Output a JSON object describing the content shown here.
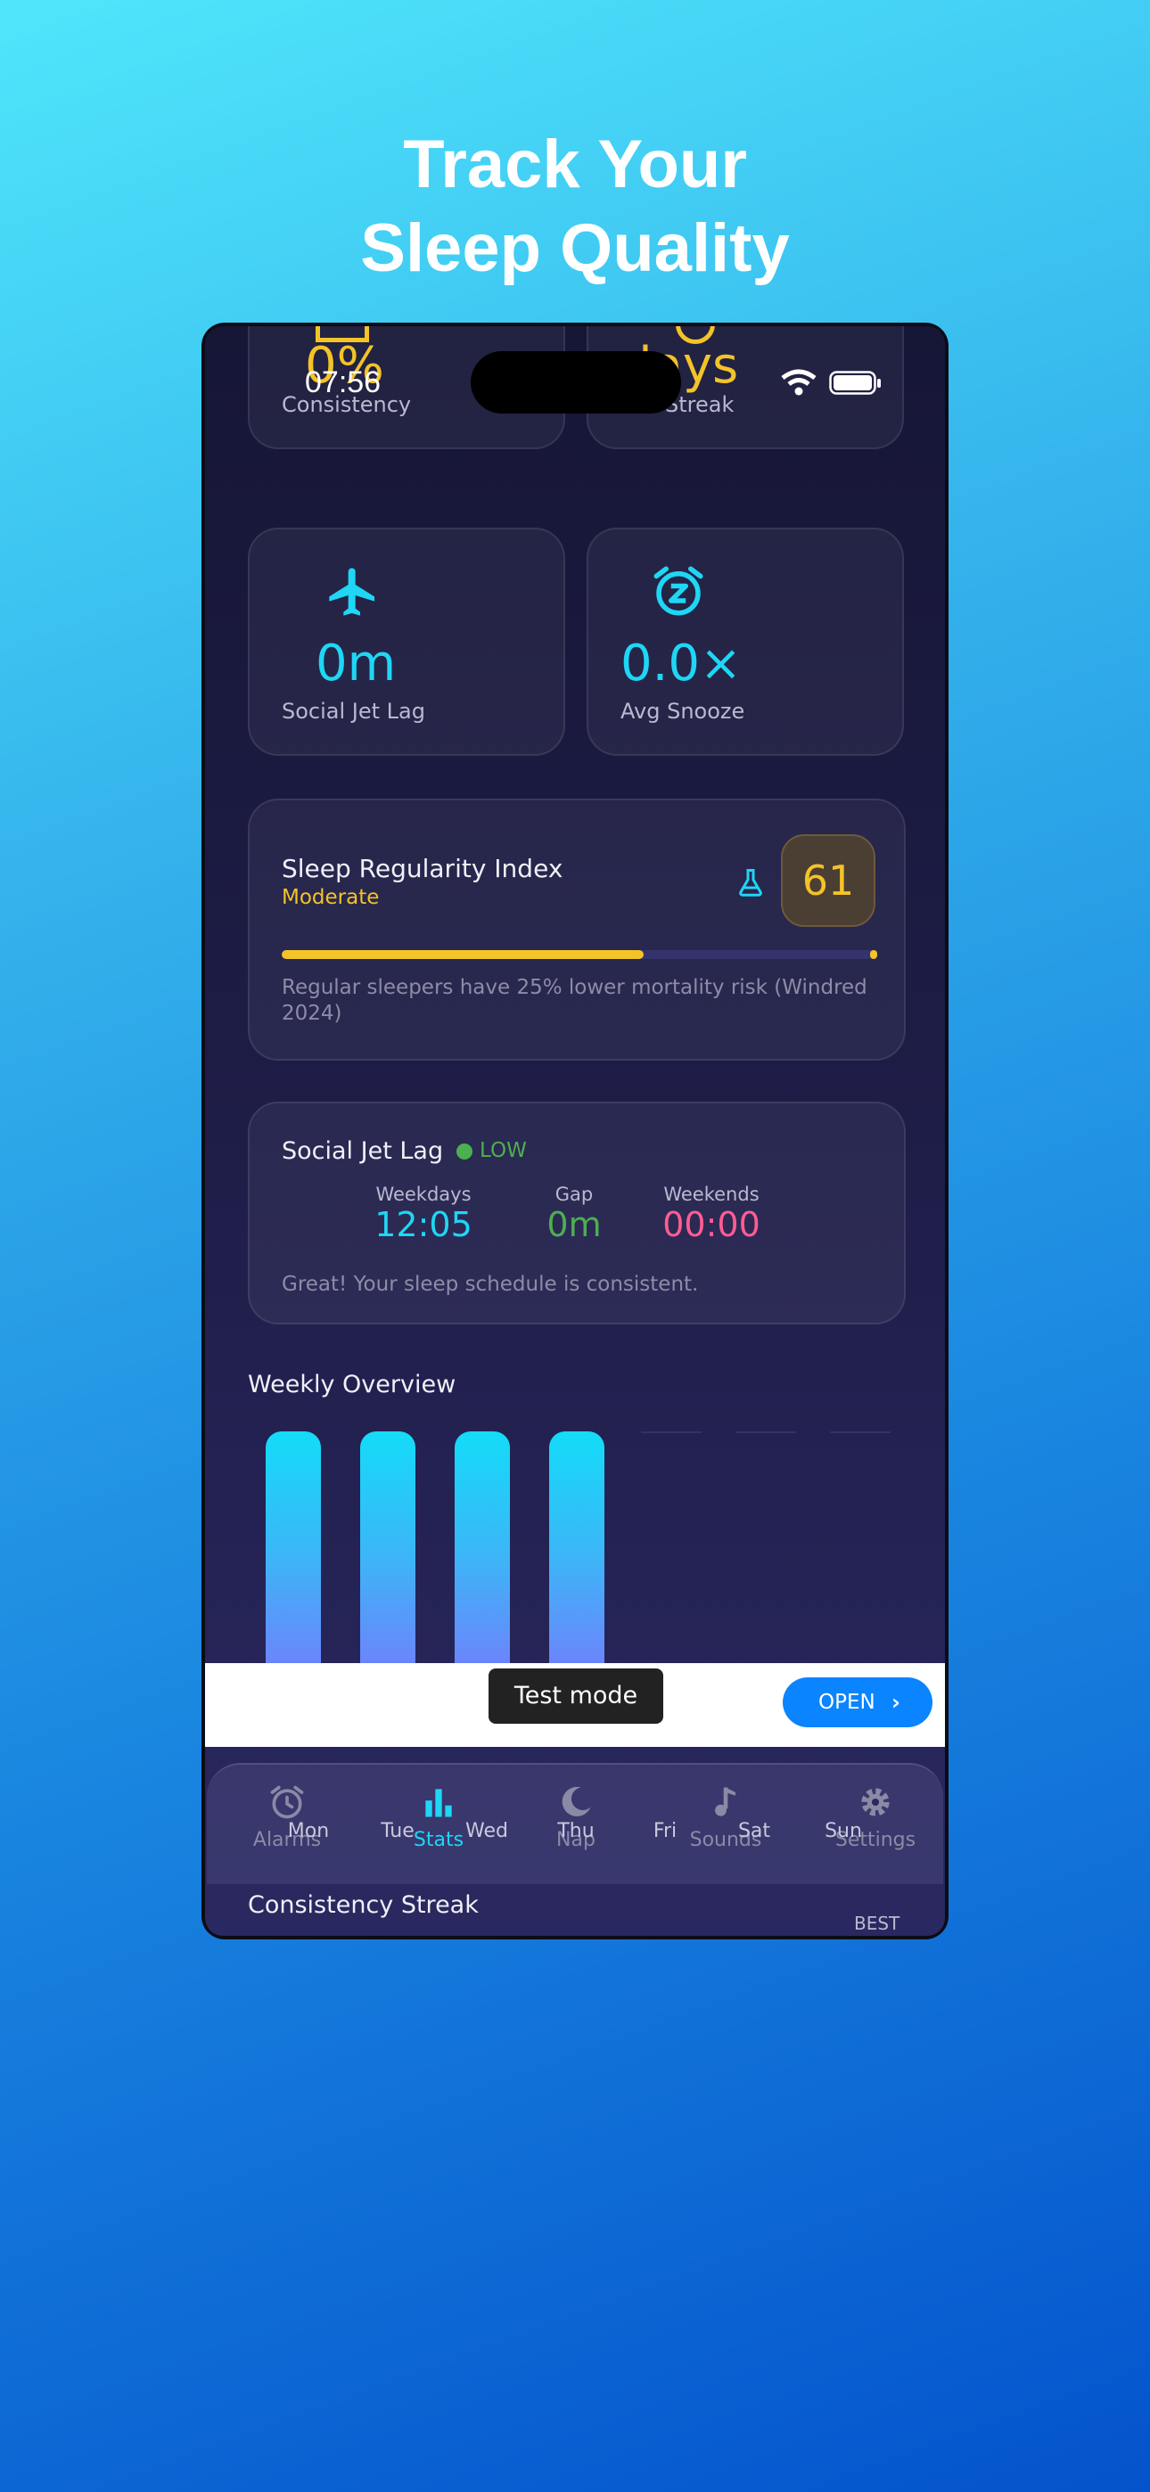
{
  "headline": {
    "line1": "Track Your",
    "line2": "Sleep Quality"
  },
  "status_bar": {
    "time": "07:56"
  },
  "stats_top": {
    "consistency": {
      "value": "0%",
      "label": "Consistency"
    },
    "streak": {
      "value": "days",
      "label": "Streak"
    }
  },
  "stats_mid": {
    "jet_lag": {
      "value": "0m",
      "label": "Social Jet Lag"
    },
    "snooze": {
      "value": "0.0×",
      "label": "Avg Snooze"
    }
  },
  "sri": {
    "title": "Sleep Regularity Index",
    "level": "Moderate",
    "score": "61",
    "progress": 0.61,
    "note": "Regular sleepers have 25% lower mortality risk (Windred 2024)"
  },
  "social_jet_lag": {
    "title": "Social Jet Lag",
    "badge": "LOW",
    "weekdays_label": "Weekdays",
    "weekdays_value": "12:05",
    "gap_label": "Gap",
    "gap_value": "0m",
    "weekends_label": "Weekends",
    "weekends_value": "00:00",
    "message": "Great! Your sleep schedule is consistent."
  },
  "weekly": {
    "title": "Weekly Overview",
    "days": [
      "Mon",
      "Tue",
      "Wed",
      "Thu",
      "Fri",
      "Sat",
      "Sun"
    ],
    "has_data": [
      true,
      true,
      true,
      true,
      false,
      false,
      false
    ]
  },
  "ad": {
    "test_label": "Test mode",
    "open_label": "OPEN"
  },
  "nav": {
    "items": [
      {
        "label": "Alarms",
        "icon": "alarm-clock-icon"
      },
      {
        "label": "Stats",
        "icon": "bar-chart-icon"
      },
      {
        "label": "Nap",
        "icon": "moon-icon"
      },
      {
        "label": "Sounds",
        "icon": "music-note-icon"
      },
      {
        "label": "Settings",
        "icon": "gear-icon"
      }
    ],
    "active": "Stats"
  },
  "streak_section": {
    "title": "Consistency Streak",
    "best_label": "BEST"
  },
  "colors": {
    "cyan": "#1fd6f5",
    "yellow": "#f3c328",
    "green": "#4caf50",
    "pink": "#ff5c93",
    "background": "#161637",
    "ad_button": "#0a84ff"
  }
}
